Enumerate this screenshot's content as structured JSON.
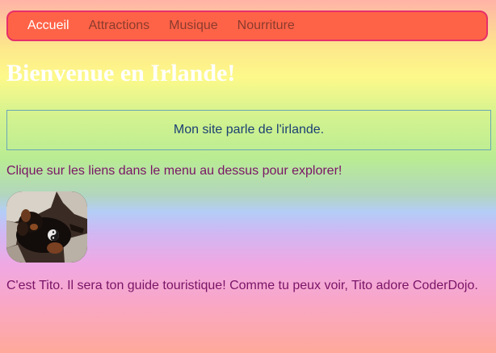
{
  "nav": {
    "items": [
      {
        "label": "Accueil",
        "active": true
      },
      {
        "label": "Attractions",
        "active": false
      },
      {
        "label": "Musique",
        "active": false
      },
      {
        "label": "Nourriture",
        "active": false
      }
    ]
  },
  "page_title": "Bienvenue en Irlande!",
  "intro_box": "Mon site parle de l'irlande.",
  "instruction": "Clique sur les liens dans le menu au dessus pour explorer!",
  "caption": "C'est Tito. Il sera ton guide touristique! Comme tu peux voir, Tito adore CoderDojo.",
  "colors": {
    "nav_background": "#ff6347",
    "nav_border": "#e62f6b",
    "title": "#ffffff",
    "text": "#7a1467",
    "intro_text": "#1b3f73"
  }
}
